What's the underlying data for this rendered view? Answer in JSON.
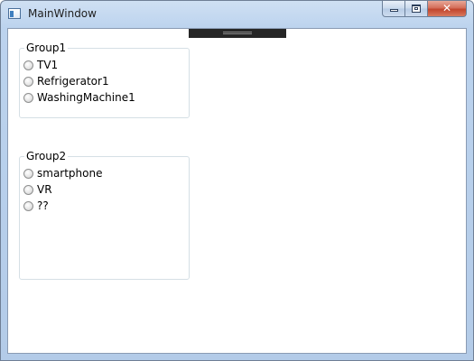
{
  "window": {
    "title": "MainWindow",
    "icon": "app-window-icon",
    "caption_buttons": {
      "minimize": "minimize-icon",
      "maximize": "maximize-icon",
      "close": "✕"
    }
  },
  "groups": [
    {
      "header": "Group1",
      "items": [
        {
          "label": "TV1",
          "checked": false
        },
        {
          "label": "Refrigerator1",
          "checked": false
        },
        {
          "label": "WashingMachine1",
          "checked": false
        }
      ]
    },
    {
      "header": "Group2",
      "items": [
        {
          "label": "smartphone",
          "checked": false
        },
        {
          "label": "VR",
          "checked": false
        },
        {
          "label": "??",
          "checked": false
        }
      ]
    }
  ],
  "colors": {
    "frame": "#b9d1ea",
    "close_button": "#c7503a",
    "group_border": "#d5dfe5",
    "splitter": "#262626"
  }
}
